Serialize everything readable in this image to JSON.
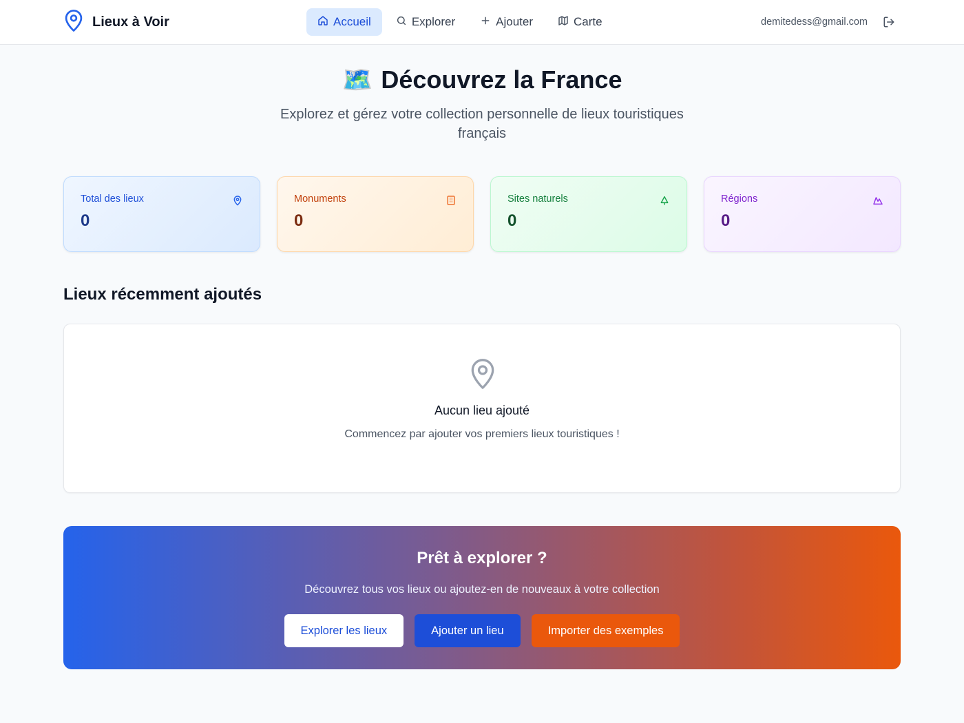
{
  "brand": {
    "name": "Lieux à Voir",
    "icon": "map-pin-icon",
    "color": "#2563eb"
  },
  "nav": {
    "items": [
      {
        "label": "Accueil",
        "icon": "home-icon",
        "active": true
      },
      {
        "label": "Explorer",
        "icon": "search-icon",
        "active": false
      },
      {
        "label": "Ajouter",
        "icon": "plus-icon",
        "active": false
      },
      {
        "label": "Carte",
        "icon": "map-icon",
        "active": false
      }
    ],
    "email": "demitedess@gmail.com",
    "logout_icon": "logout-icon"
  },
  "hero": {
    "emoji": "🗺️",
    "title": "Découvrez la France",
    "subtitle": "Explorez et gérez votre collection personnelle de lieux touristiques français"
  },
  "stats": [
    {
      "label": "Total des lieux",
      "value": "0",
      "icon": "map-pin-icon",
      "accent": "#1d4ed8"
    },
    {
      "label": "Monuments",
      "value": "0",
      "icon": "building-icon",
      "accent": "#c2410c"
    },
    {
      "label": "Sites naturels",
      "value": "0",
      "icon": "tree-icon",
      "accent": "#15803d"
    },
    {
      "label": "Régions",
      "value": "0",
      "icon": "mountain-icon",
      "accent": "#7e22ce"
    }
  ],
  "recent": {
    "title": "Lieux récemment ajoutés",
    "empty_title": "Aucun lieu ajouté",
    "empty_subtitle": "Commencez par ajouter vos premiers lieux touristiques !"
  },
  "cta": {
    "title": "Prêt à explorer ?",
    "subtitle": "Découvrez tous vos lieux ou ajoutez-en de nouveaux à votre collection",
    "buttons": {
      "explore": "Explorer les lieux",
      "add": "Ajouter un lieu",
      "import": "Importer des exemples"
    }
  }
}
